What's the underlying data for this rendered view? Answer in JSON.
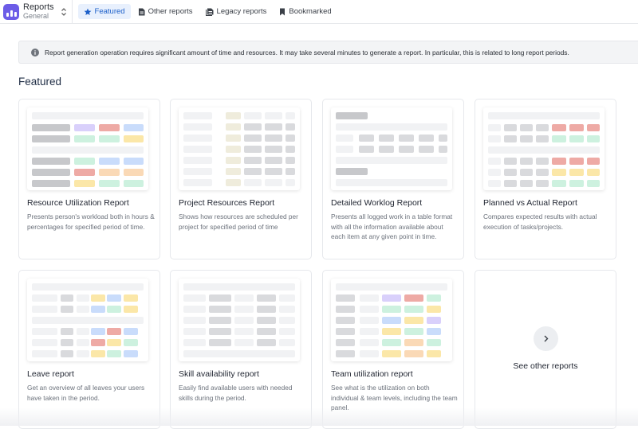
{
  "app": {
    "title": "Reports",
    "subtitle": "General",
    "accent": "#6c5ce7"
  },
  "tabs": [
    {
      "label": "Featured",
      "icon": "star-icon",
      "active": true
    },
    {
      "label": "Other reports",
      "icon": "document-icon",
      "active": false
    },
    {
      "label": "Legacy reports",
      "icon": "document-stack-icon",
      "active": false
    },
    {
      "label": "Bookmarked",
      "icon": "bookmark-icon",
      "active": false
    }
  ],
  "banner": {
    "icon": "info-icon",
    "text": "Report generation operation requires significant amount of time and resources. It may take several minutes to generate a report. In particular, this is related to long report periods."
  },
  "section": {
    "title": "Featured"
  },
  "cards": [
    {
      "title": "Resource Utilization Report",
      "description": "Presents person's workload both in hours & percentages for specified period of time."
    },
    {
      "title": "Project Resources Report",
      "description": "Shows how resources are scheduled per project for specified period of time"
    },
    {
      "title": "Detailed Worklog Report",
      "description": "Presents all logged work in a table format with all the information available about each item at any given point in time."
    },
    {
      "title": "Planned vs Actual Report",
      "description": "Compares expected results with actual execution of tasks/projects."
    },
    {
      "title": "Leave report",
      "description": "Get an overview of all leaves your users have taken in the period."
    },
    {
      "title": "Skill availability report",
      "description": "Easily find available users with needed skills during the period."
    },
    {
      "title": "Team utilization report",
      "description": "See what is the utilization on both individual & team levels, including the team panel."
    }
  ],
  "see_other": {
    "label": "See other reports",
    "icon": "chevron-right-icon"
  },
  "colors": {
    "gray_light": "#f1f2f4",
    "gray": "#d9dadd",
    "gray_dark": "#c7c8cb",
    "purple": "#d9d0fb",
    "red": "#eeaaa5",
    "blue": "#c9dcfb",
    "green": "#cdf1df",
    "yellow": "#fbe7a8",
    "orange": "#fad9b6",
    "beige": "#efecdc"
  }
}
